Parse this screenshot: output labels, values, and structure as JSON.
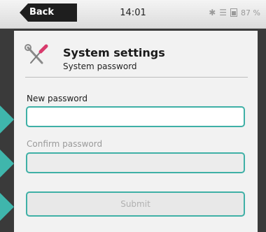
{
  "topbar": {
    "back_label": "Back",
    "time": "14:01",
    "battery_percent": "87 %",
    "icons": [
      "bluetooth-icon",
      "wifi-icon",
      "battery-icon"
    ]
  },
  "header": {
    "title": "System settings",
    "subtitle": "System password",
    "icon": "wrench-screwdriver-icon"
  },
  "form": {
    "new_password_label": "New password",
    "new_password_value": "",
    "confirm_password_label": "Confirm password",
    "confirm_password_value": "",
    "submit_label": "Submit"
  },
  "colors": {
    "accent": "#3fb0a6",
    "panel": "#f2f2f2",
    "background": "#3a3a3a"
  }
}
